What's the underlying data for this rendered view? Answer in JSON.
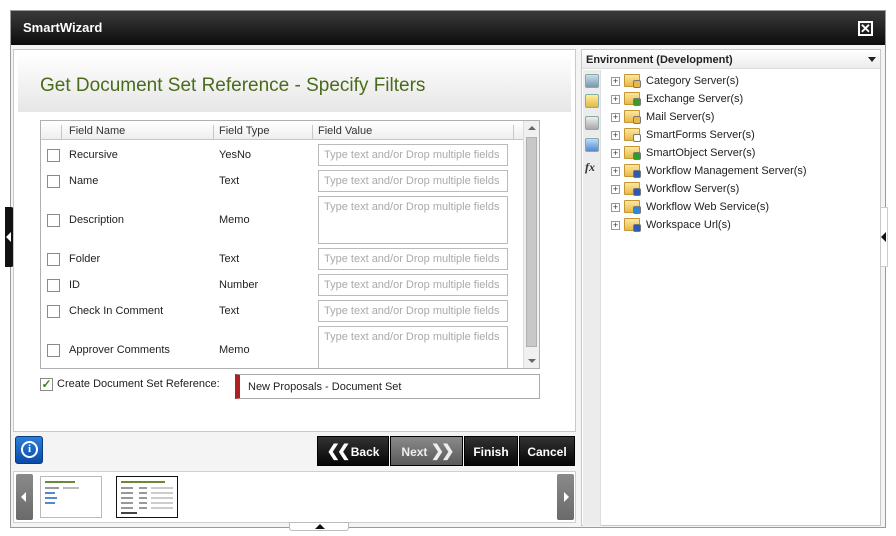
{
  "window": {
    "title": "SmartWizard",
    "close_glyph": "✕"
  },
  "wizard": {
    "heading": "Get Document Set Reference - Specify Filters",
    "columns": [
      "Field Name",
      "Field Type",
      "Field Value"
    ],
    "placeholder": "Type text and/or Drop multiple fields",
    "rows": [
      {
        "name": "Recursive",
        "type": "YesNo"
      },
      {
        "name": "Name",
        "type": "Text"
      },
      {
        "name": "Description",
        "type": "Memo"
      },
      {
        "name": "Folder",
        "type": "Text"
      },
      {
        "name": "ID",
        "type": "Number"
      },
      {
        "name": "Check In Comment",
        "type": "Text"
      },
      {
        "name": "Approver Comments",
        "type": "Memo"
      }
    ],
    "create_ref": {
      "label": "Create Document Set Reference:",
      "checked": true,
      "value": "New Proposals - Document Set"
    }
  },
  "nav": {
    "back": "Back",
    "next": "Next",
    "finish": "Finish",
    "cancel": "Cancel",
    "info_glyph": "i"
  },
  "env": {
    "title": "Environment (Development)",
    "tools": [
      "fx"
    ],
    "items": [
      {
        "label": "Category Server(s)",
        "icon": "category-folder-icon",
        "badge": "#e8b84a"
      },
      {
        "label": "Exchange Server(s)",
        "icon": "exchange-folder-icon",
        "badge": "#3a9a2a"
      },
      {
        "label": "Mail Server(s)",
        "icon": "mail-folder-icon",
        "badge": "#e8b84a"
      },
      {
        "label": "SmartForms Server(s)",
        "icon": "smartforms-folder-icon",
        "badge": "#ffffff"
      },
      {
        "label": "SmartObject Server(s)",
        "icon": "smartobject-folder-icon",
        "badge": "#2aa02a"
      },
      {
        "label": "Workflow Management Server(s)",
        "icon": "workflow-mgmt-folder-icon",
        "badge": "#2a5ab8"
      },
      {
        "label": "Workflow Server(s)",
        "icon": "workflow-folder-icon",
        "badge": "#2a5ab8"
      },
      {
        "label": "Workflow Web Service(s)",
        "icon": "web-service-folder-icon",
        "badge": "#2a8ad8"
      },
      {
        "label": "Workspace Url(s)",
        "icon": "workspace-folder-icon",
        "badge": "#2a5ab8"
      }
    ],
    "expand_glyph": "+"
  }
}
